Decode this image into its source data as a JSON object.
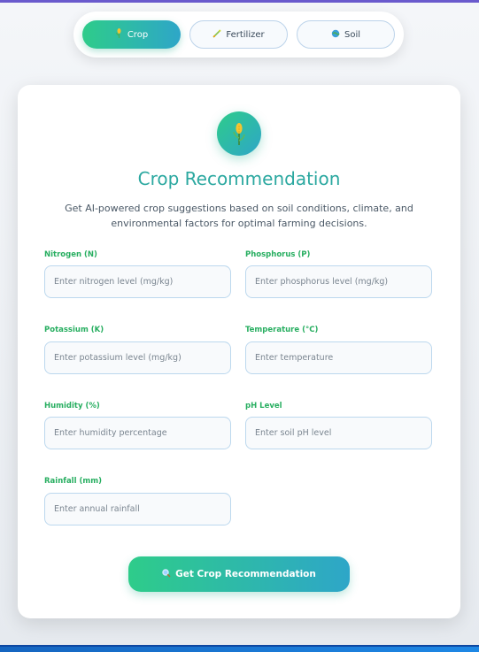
{
  "tabs": [
    {
      "label": "Crop",
      "icon": "crop-icon",
      "active": true
    },
    {
      "label": "Fertilizer",
      "icon": "fertilizer-icon",
      "active": false
    },
    {
      "label": "Soil",
      "icon": "soil-icon",
      "active": false
    }
  ],
  "card": {
    "icon": "crop-icon",
    "title": "Crop Recommendation",
    "subtitle": "Get AI-powered crop suggestions based on soil conditions, climate, and environmental factors for optimal farming decisions."
  },
  "fields": [
    {
      "label": "Nitrogen (N)",
      "placeholder": "Enter nitrogen level (mg/kg)",
      "value": ""
    },
    {
      "label": "Phosphorus (P)",
      "placeholder": "Enter phosphorus level (mg/kg)",
      "value": ""
    },
    {
      "label": "Potassium (K)",
      "placeholder": "Enter potassium level (mg/kg)",
      "value": ""
    },
    {
      "label": "Temperature (°C)",
      "placeholder": "Enter temperature",
      "value": ""
    },
    {
      "label": "Humidity (%)",
      "placeholder": "Enter humidity percentage",
      "value": ""
    },
    {
      "label": "pH Level",
      "placeholder": "Enter soil pH level",
      "value": ""
    },
    {
      "label": "Rainfall (mm)",
      "placeholder": "Enter annual rainfall",
      "value": ""
    }
  ],
  "submit": {
    "label": "Get Crop Recommendation",
    "icon": "search-icon"
  },
  "colors": {
    "accent_start": "#2ecc8a",
    "accent_end": "#2ea6c8",
    "label_green": "#27ae60",
    "title_teal": "#2ba8a0"
  }
}
